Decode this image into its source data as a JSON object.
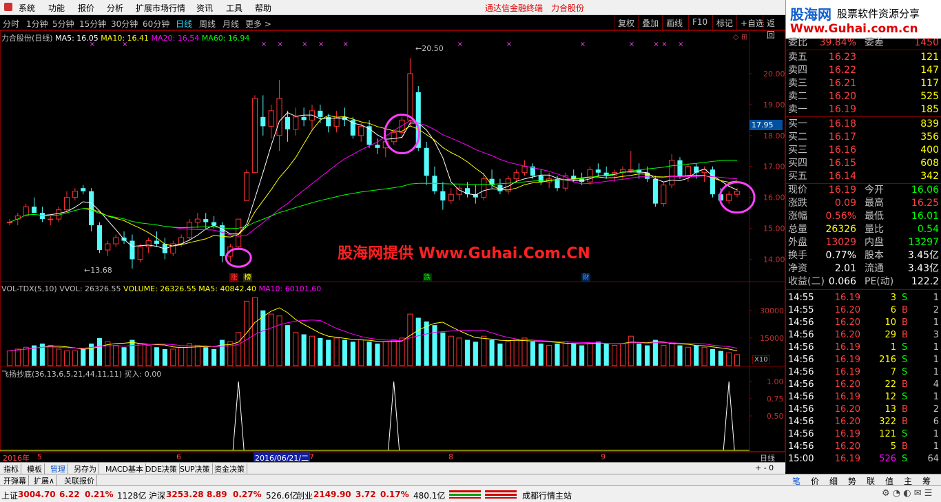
{
  "menu": {
    "items": [
      "系统",
      "功能",
      "报价",
      "分析",
      "扩展市场行情",
      "资讯",
      "工具",
      "帮助"
    ],
    "right1": "通达信金融终端",
    "right2": "力合股份"
  },
  "period_tabs": [
    "分时",
    "1分钟",
    "5分钟",
    "15分钟",
    "30分钟",
    "60分钟",
    "日线",
    "周线",
    "月线",
    "更多 >"
  ],
  "toolbar": [
    "复权",
    "叠加",
    "画线",
    "F10",
    "标记",
    "+自选",
    "返回"
  ],
  "logo": {
    "title": "股海网",
    "subtitle": "股票软件资源分享",
    "url": "Www.Guhai.com.cn"
  },
  "main_chart": {
    "title": "力合股份(日线)",
    "ma_labels": [
      {
        "t": "MA5: 16.05",
        "c": "#ffffff"
      },
      {
        "t": "MA10: 16.41",
        "c": "#ffff00"
      },
      {
        "t": "MA20: 16.54",
        "c": "#ff00ff"
      },
      {
        "t": "MA60: 16.94",
        "c": "#00ff00"
      }
    ],
    "price_ticks": [
      "20.00",
      "19.00",
      "18.00",
      "17.00",
      "16.00",
      "15.00",
      "14.00"
    ],
    "current_price": "17.95",
    "high_label": "20.50",
    "low_label": "13.68",
    "watermark": "股海网提供 Www.Guhai.Com.CN",
    "markers": [
      {
        "t": "涨",
        "c": "#ff4040"
      },
      {
        "t": "榜",
        "c": "#ffff00"
      },
      {
        "t": "跌",
        "c": "#00ff00"
      },
      {
        "t": "财",
        "c": "#40a0ff"
      }
    ]
  },
  "volume_panel": {
    "labels": [
      {
        "t": "VOL-TDX(5,10)",
        "c": "#c0c0c0"
      },
      {
        "t": "VVOL: 26326.55",
        "c": "#c0c0c0"
      },
      {
        "t": "VOLUME: 26326.55",
        "c": "#ffff00"
      },
      {
        "t": "MA5: 40842.40",
        "c": "#ffff00"
      },
      {
        "t": "MA10: 60101.60",
        "c": "#ff00ff"
      }
    ],
    "ticks": [
      "30000",
      "15000"
    ],
    "unit": "X10"
  },
  "indicator_panel": {
    "label": "飞扬抄底(36,13,6,5,21,44,11,11)",
    "buy_label": "买入: 0.00",
    "ticks": [
      "1.00",
      "0.75",
      "0.50"
    ]
  },
  "date_axis": {
    "year": "2016年",
    "months": [
      "5",
      "6",
      "7",
      "8",
      "9"
    ],
    "cursor": "2016/06/21/二",
    "period": "日线"
  },
  "bottom_tabs": [
    "指标",
    "模板",
    "管理",
    "另存为",
    "MACD基本",
    "DDE决策",
    "SUP决策",
    "资金决策"
  ],
  "bottom_tabs2": [
    "开弹幕",
    "扩展∧",
    "关联报价"
  ],
  "order_book": {
    "wei": {
      "label1": "委比",
      "v1": "39.84%",
      "label2": "委差",
      "v2": "1450"
    },
    "sell": [
      {
        "l": "卖五",
        "p": "16.23",
        "v": "121"
      },
      {
        "l": "卖四",
        "p": "16.22",
        "v": "147"
      },
      {
        "l": "卖三",
        "p": "16.21",
        "v": "117"
      },
      {
        "l": "卖二",
        "p": "16.20",
        "v": "525"
      },
      {
        "l": "卖一",
        "p": "16.19",
        "v": "185"
      }
    ],
    "buy": [
      {
        "l": "买一",
        "p": "16.18",
        "v": "839"
      },
      {
        "l": "买二",
        "p": "16.17",
        "v": "356"
      },
      {
        "l": "买三",
        "p": "16.16",
        "v": "400"
      },
      {
        "l": "买四",
        "p": "16.15",
        "v": "608"
      },
      {
        "l": "买五",
        "p": "16.14",
        "v": "342"
      }
    ]
  },
  "quote_info": [
    {
      "l1": "现价",
      "v1": "16.19",
      "c1": "#ff4040",
      "l2": "今开",
      "v2": "16.06",
      "c2": "#00ff00"
    },
    {
      "l1": "涨跌",
      "v1": "0.09",
      "c1": "#ff4040",
      "l2": "最高",
      "v2": "16.25",
      "c2": "#ff4040"
    },
    {
      "l1": "涨幅",
      "v1": "0.56%",
      "c1": "#ff4040",
      "l2": "最低",
      "v2": "16.01",
      "c2": "#00ff00"
    },
    {
      "l1": "总量",
      "v1": "26326",
      "c1": "#ffff00",
      "l2": "量比",
      "v2": "0.54",
      "c2": "#00ff00"
    },
    {
      "l1": "外盘",
      "v1": "13029",
      "c1": "#ff4040",
      "l2": "内盘",
      "v2": "13297",
      "c2": "#00ff00"
    },
    {
      "l1": "换手",
      "v1": "0.77%",
      "c1": "#ffffff",
      "l2": "股本",
      "v2": "3.45亿",
      "c2": "#ffffff"
    },
    {
      "l1": "净资",
      "v1": "2.01",
      "c1": "#ffffff",
      "l2": "流通",
      "v2": "3.43亿",
      "c2": "#ffffff"
    },
    {
      "l1": "收益(二)",
      "v1": "0.066",
      "c1": "#ffffff",
      "l2": "PE(动)",
      "v2": "122.2",
      "c2": "#ffffff"
    }
  ],
  "trades": [
    {
      "t": "14:55",
      "p": "16.19",
      "v": "3",
      "s": "S",
      "n": "1"
    },
    {
      "t": "14:55",
      "p": "16.20",
      "v": "6",
      "s": "B",
      "n": "2"
    },
    {
      "t": "14:56",
      "p": "16.20",
      "v": "10",
      "s": "B",
      "n": "1"
    },
    {
      "t": "14:56",
      "p": "16.20",
      "v": "29",
      "s": "B",
      "n": "3"
    },
    {
      "t": "14:56",
      "p": "16.19",
      "v": "1",
      "s": "S",
      "n": "1"
    },
    {
      "t": "14:56",
      "p": "16.19",
      "v": "216",
      "s": "S",
      "n": "1"
    },
    {
      "t": "14:56",
      "p": "16.19",
      "v": "7",
      "s": "S",
      "n": "1"
    },
    {
      "t": "14:56",
      "p": "16.20",
      "v": "22",
      "s": "B",
      "n": "4"
    },
    {
      "t": "14:56",
      "p": "16.19",
      "v": "12",
      "s": "S",
      "n": "1"
    },
    {
      "t": "14:56",
      "p": "16.20",
      "v": "13",
      "s": "B",
      "n": "2"
    },
    {
      "t": "14:56",
      "p": "16.20",
      "v": "322",
      "s": "B",
      "n": "6"
    },
    {
      "t": "14:56",
      "p": "16.19",
      "v": "121",
      "s": "S",
      "n": "1"
    },
    {
      "t": "14:56",
      "p": "16.20",
      "v": "5",
      "s": "B",
      "n": "1"
    },
    {
      "t": "15:00",
      "p": "16.19",
      "v": "526",
      "s": "S",
      "n": "64"
    }
  ],
  "right_tabs": [
    "笔",
    "价",
    "细",
    "势",
    "联",
    "值",
    "主",
    "筹"
  ],
  "status": {
    "sh_name": "上证",
    "sh_val": "3004.70",
    "sh_chg": "6.22",
    "sh_pct": "0.21%",
    "sh_amt": "1128亿",
    "sz_name": "沪深",
    "sz_val": "3253.28",
    "sz_chg": "8.89",
    "sz_pct": "0.27%",
    "sz_amt": "526.6亿",
    "cy_name": "创业",
    "cy_val": "2149.90",
    "cy_chg": "3.72",
    "cy_pct": "0.17%",
    "cy_amt": "480.1亿",
    "station": "成都行情主站"
  },
  "chart_data": {
    "type": "candlestick",
    "title": "力合股份(日线)",
    "ylim": [
      13.5,
      21.0
    ],
    "candles": [
      [
        15.2,
        15.3,
        15.1,
        15.2
      ],
      [
        15.3,
        15.5,
        15.1,
        15.4
      ],
      [
        15.4,
        15.8,
        15.4,
        15.7
      ],
      [
        15.7,
        16.0,
        15.5,
        15.5
      ],
      [
        15.5,
        15.7,
        15.2,
        15.3
      ],
      [
        15.3,
        15.4,
        15.1,
        15.3
      ],
      [
        15.3,
        15.7,
        15.2,
        15.6
      ],
      [
        15.6,
        16.2,
        15.5,
        16.0
      ],
      [
        16.0,
        16.3,
        15.9,
        16.2
      ],
      [
        16.3,
        16.4,
        16.1,
        16.2
      ],
      [
        16.2,
        16.3,
        14.9,
        15.1
      ],
      [
        15.1,
        15.2,
        14.2,
        14.3
      ],
      [
        14.3,
        14.6,
        14.1,
        14.5
      ],
      [
        14.5,
        14.8,
        14.4,
        14.7
      ],
      [
        14.7,
        14.9,
        14.5,
        14.6
      ],
      [
        14.6,
        14.8,
        13.7,
        14.0
      ],
      [
        14.0,
        14.5,
        13.9,
        14.4
      ],
      [
        14.4,
        14.7,
        14.2,
        14.6
      ],
      [
        14.6,
        14.9,
        14.4,
        14.5
      ],
      [
        14.5,
        14.7,
        14.0,
        14.2
      ],
      [
        14.2,
        14.6,
        14.1,
        14.5
      ],
      [
        14.5,
        14.8,
        14.4,
        14.7
      ],
      [
        14.7,
        15.3,
        14.6,
        15.2
      ],
      [
        15.2,
        15.5,
        15.0,
        15.3
      ],
      [
        15.3,
        15.5,
        15.0,
        15.2
      ],
      [
        15.2,
        15.4,
        15.0,
        15.1
      ],
      [
        15.1,
        15.2,
        13.9,
        14.1
      ],
      [
        14.1,
        14.5,
        13.9,
        14.4
      ],
      [
        14.4,
        15.3,
        14.3,
        15.3
      ],
      [
        15.9,
        16.9,
        15.9,
        16.8
      ],
      [
        16.8,
        19.3,
        16.8,
        19.2
      ],
      [
        18.6,
        19.3,
        18.0,
        18.3
      ],
      [
        18.3,
        19.0,
        17.9,
        18.8
      ],
      [
        18.0,
        19.8,
        17.5,
        19.2
      ],
      [
        18.6,
        18.8,
        17.8,
        18.2
      ],
      [
        18.2,
        18.9,
        18.0,
        18.6
      ],
      [
        18.6,
        18.9,
        18.3,
        18.5
      ],
      [
        18.5,
        19.0,
        18.2,
        18.8
      ],
      [
        18.8,
        19.0,
        18.4,
        18.6
      ],
      [
        18.6,
        18.7,
        18.1,
        18.3
      ],
      [
        18.3,
        18.8,
        18.1,
        18.6
      ],
      [
        18.6,
        18.9,
        18.3,
        18.5
      ],
      [
        18.5,
        18.6,
        17.9,
        18.0
      ],
      [
        18.0,
        18.4,
        17.8,
        18.3
      ],
      [
        18.3,
        18.5,
        17.6,
        17.7
      ],
      [
        17.7,
        17.9,
        17.4,
        17.6
      ],
      [
        17.6,
        17.9,
        17.3,
        17.8
      ],
      [
        17.8,
        18.2,
        17.7,
        18.1
      ],
      [
        18.1,
        18.6,
        17.9,
        18.5
      ],
      [
        18.5,
        20.5,
        18.3,
        20.0
      ],
      [
        19.4,
        19.6,
        17.5,
        17.6
      ],
      [
        17.6,
        17.8,
        16.4,
        16.7
      ],
      [
        16.7,
        17.0,
        16.1,
        16.2
      ],
      [
        16.2,
        16.5,
        15.6,
        15.9
      ],
      [
        15.9,
        16.3,
        15.8,
        16.1
      ],
      [
        16.1,
        16.4,
        15.9,
        16.3
      ],
      [
        16.3,
        16.5,
        16.0,
        16.1
      ],
      [
        16.1,
        16.4,
        15.8,
        16.0
      ],
      [
        16.0,
        16.8,
        15.9,
        16.6
      ],
      [
        16.6,
        16.9,
        16.3,
        16.4
      ],
      [
        16.4,
        16.6,
        16.1,
        16.2
      ],
      [
        16.2,
        16.7,
        16.1,
        16.6
      ],
      [
        16.6,
        16.9,
        16.5,
        16.8
      ],
      [
        16.8,
        17.2,
        16.7,
        17.0
      ],
      [
        17.0,
        17.1,
        16.6,
        16.7
      ],
      [
        16.7,
        16.9,
        16.4,
        16.5
      ],
      [
        16.5,
        16.8,
        16.3,
        16.6
      ],
      [
        16.6,
        16.7,
        16.2,
        16.3
      ],
      [
        16.3,
        16.8,
        16.2,
        16.7
      ],
      [
        16.7,
        16.9,
        16.5,
        16.6
      ],
      [
        16.6,
        16.8,
        16.4,
        16.5
      ],
      [
        16.5,
        17.0,
        16.4,
        16.9
      ],
      [
        16.9,
        17.1,
        16.7,
        16.8
      ],
      [
        16.8,
        17.0,
        16.6,
        16.7
      ],
      [
        16.7,
        16.9,
        16.5,
        16.8
      ],
      [
        16.8,
        17.0,
        16.6,
        16.9
      ],
      [
        16.9,
        17.5,
        16.8,
        16.9
      ],
      [
        16.9,
        17.1,
        16.6,
        16.8
      ],
      [
        16.8,
        17.0,
        16.5,
        16.6
      ],
      [
        16.6,
        16.7,
        15.7,
        15.8
      ],
      [
        15.8,
        16.5,
        15.7,
        16.4
      ],
      [
        16.4,
        17.4,
        16.3,
        17.2
      ],
      [
        17.2,
        17.3,
        16.6,
        16.7
      ],
      [
        16.7,
        17.1,
        16.5,
        17.0
      ],
      [
        17.0,
        17.1,
        16.6,
        16.8
      ],
      [
        16.8,
        17.0,
        16.5,
        16.9
      ],
      [
        16.9,
        17.0,
        16.0,
        16.1
      ],
      [
        16.1,
        16.3,
        15.8,
        15.9
      ],
      [
        15.9,
        16.2,
        15.8,
        16.1
      ],
      [
        16.1,
        16.3,
        16.0,
        16.2
      ]
    ],
    "volume": [
      8,
      9,
      10,
      11,
      12,
      11,
      9,
      8,
      8,
      9,
      12,
      15,
      13,
      11,
      10,
      14,
      12,
      11,
      10,
      9,
      9,
      10,
      12,
      11,
      10,
      9,
      14,
      13,
      18,
      35,
      37,
      30,
      28,
      27,
      22,
      18,
      17,
      16,
      15,
      14,
      15,
      14,
      13,
      14,
      13,
      12,
      13,
      14,
      15,
      28,
      26,
      24,
      22,
      18,
      16,
      15,
      14,
      13,
      16,
      14,
      12,
      13,
      14,
      15,
      13,
      12,
      11,
      12,
      13,
      12,
      11,
      12,
      13,
      12,
      11,
      12,
      16,
      12,
      11,
      14,
      11,
      12,
      11,
      10,
      11,
      10,
      9,
      8,
      7,
      6
    ],
    "signal_x": [
      28,
      47,
      88
    ]
  }
}
